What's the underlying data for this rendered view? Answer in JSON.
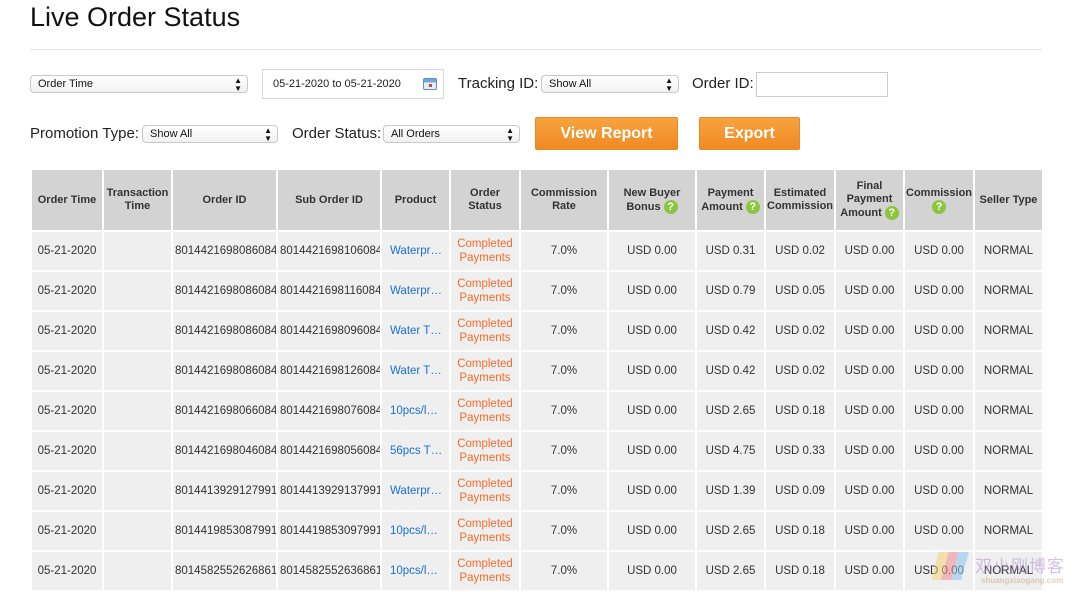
{
  "page": {
    "title": "Live Order Status"
  },
  "filters": {
    "time_type": "Order Time",
    "date_range": "05-21-2020 to 05-21-2020",
    "tracking_id_label": "Tracking ID:",
    "tracking_id_value": "Show All",
    "order_id_label": "Order ID:",
    "order_id_value": "",
    "promotion_type_label": "Promotion Type:",
    "promotion_type_value": "Show All",
    "order_status_label": "Order Status:",
    "order_status_value": "All Orders",
    "view_report": "View Report",
    "export": "Export"
  },
  "table": {
    "columns": [
      {
        "label": "Order Time",
        "help": false
      },
      {
        "label": "Transaction Time",
        "help": false
      },
      {
        "label": "Order ID",
        "help": false
      },
      {
        "label": "Sub Order ID",
        "help": false
      },
      {
        "label": "Product",
        "help": false
      },
      {
        "label": "Order Status",
        "help": false
      },
      {
        "label": "Commission Rate",
        "help": false
      },
      {
        "label": "New Buyer Bonus",
        "help": true
      },
      {
        "label": "Payment Amount",
        "help": true
      },
      {
        "label": "Estimated Commission",
        "help": false
      },
      {
        "label": "Final Payment Amount",
        "help": true
      },
      {
        "label": "Commission",
        "help": true
      },
      {
        "label": "Seller Type",
        "help": false
      }
    ],
    "rows": [
      [
        "05-21-2020",
        "",
        "8014421698086084",
        "8014421698106084",
        "Waterpr…",
        "Completed Payments",
        "7.0%",
        "USD 0.00",
        "USD 0.31",
        "USD 0.02",
        "USD 0.00",
        "USD 0.00",
        "NORMAL"
      ],
      [
        "05-21-2020",
        "",
        "8014421698086084",
        "8014421698116084",
        "Waterpr…",
        "Completed Payments",
        "7.0%",
        "USD 0.00",
        "USD 0.79",
        "USD 0.05",
        "USD 0.00",
        "USD 0.00",
        "NORMAL"
      ],
      [
        "05-21-2020",
        "",
        "8014421698086084",
        "8014421698096084",
        "Water T…",
        "Completed Payments",
        "7.0%",
        "USD 0.00",
        "USD 0.42",
        "USD 0.02",
        "USD 0.00",
        "USD 0.00",
        "NORMAL"
      ],
      [
        "05-21-2020",
        "",
        "8014421698086084",
        "8014421698126084",
        "Water T…",
        "Completed Payments",
        "7.0%",
        "USD 0.00",
        "USD 0.42",
        "USD 0.02",
        "USD 0.00",
        "USD 0.00",
        "NORMAL"
      ],
      [
        "05-21-2020",
        "",
        "8014421698066084",
        "8014421698076084",
        "10pcs/l…",
        "Completed Payments",
        "7.0%",
        "USD 0.00",
        "USD 2.65",
        "USD 0.18",
        "USD 0.00",
        "USD 0.00",
        "NORMAL"
      ],
      [
        "05-21-2020",
        "",
        "8014421698046084",
        "8014421698056084",
        "56pcs T…",
        "Completed Payments",
        "7.0%",
        "USD 0.00",
        "USD 4.75",
        "USD 0.33",
        "USD 0.00",
        "USD 0.00",
        "NORMAL"
      ],
      [
        "05-21-2020",
        "",
        "8014413929127991",
        "8014413929137991",
        "Waterpr…",
        "Completed Payments",
        "7.0%",
        "USD 0.00",
        "USD 1.39",
        "USD 0.09",
        "USD 0.00",
        "USD 0.00",
        "NORMAL"
      ],
      [
        "05-21-2020",
        "",
        "8014419853087991",
        "8014419853097991",
        "10pcs/l…",
        "Completed Payments",
        "7.0%",
        "USD 0.00",
        "USD 2.65",
        "USD 0.18",
        "USD 0.00",
        "USD 0.00",
        "NORMAL"
      ],
      [
        "05-21-2020",
        "",
        "8014582552626861",
        "8014582552636861",
        "10pcs/l…",
        "Completed Payments",
        "7.0%",
        "USD 0.00",
        "USD 2.65",
        "USD 0.18",
        "USD 0.00",
        "USD 0.00",
        "NORMAL"
      ]
    ]
  },
  "watermark": {
    "cn": "双小刚博客",
    "en": "shuangxiaogang.com"
  },
  "colors": {
    "accent": "#f08a24",
    "link": "#1a6fd6",
    "status": "#f26b2a",
    "help": "#8cc63e"
  }
}
